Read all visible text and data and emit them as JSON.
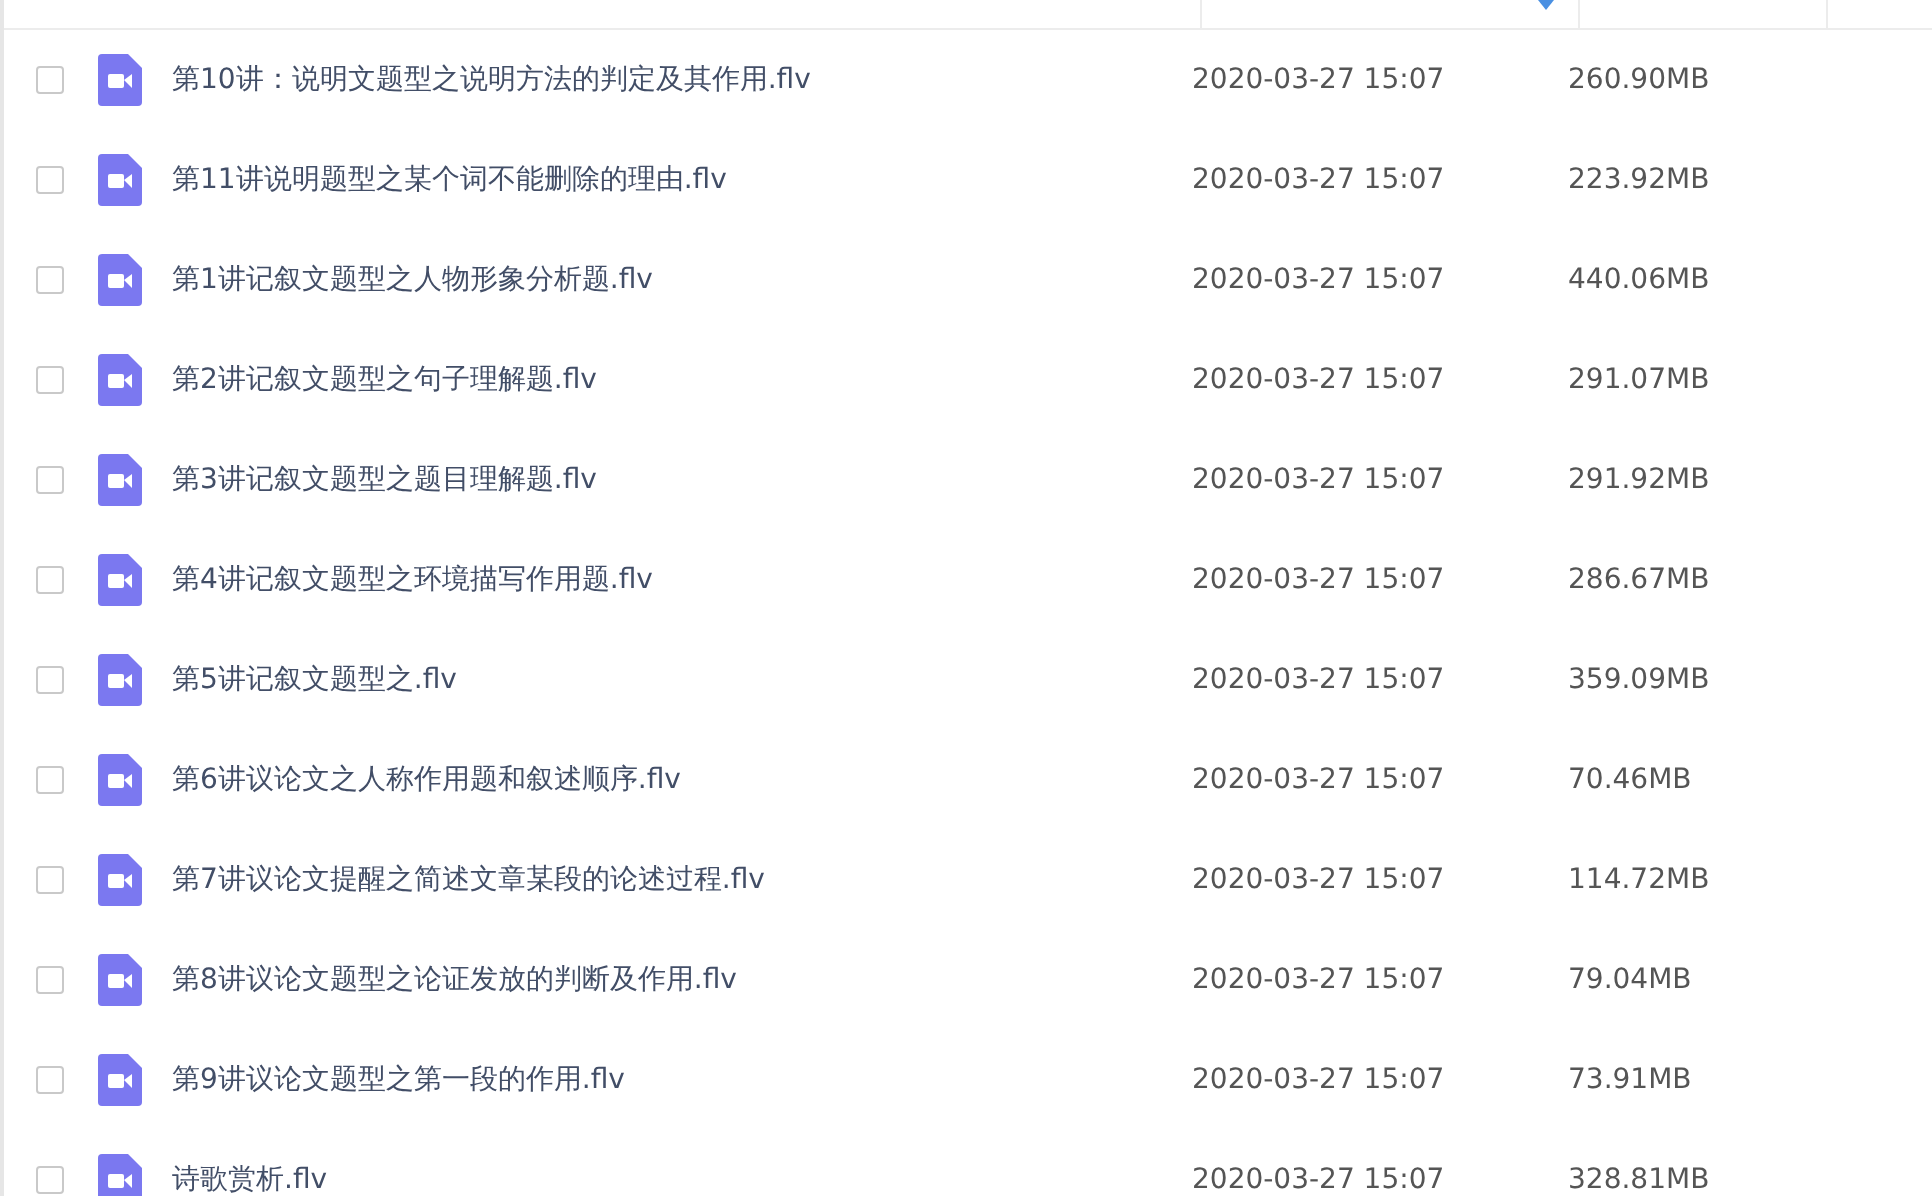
{
  "files": [
    {
      "name": "第10讲：说明文题型之说明方法的判定及其作用.flv",
      "modified": "2020-03-27 15:07",
      "size": "260.90MB",
      "checked": false
    },
    {
      "name": "第11讲说明题型之某个词不能删除的理由.flv",
      "modified": "2020-03-27 15:07",
      "size": "223.92MB",
      "checked": false
    },
    {
      "name": "第1讲记叙文题型之人物形象分析题.flv",
      "modified": "2020-03-27 15:07",
      "size": "440.06MB",
      "checked": false
    },
    {
      "name": "第2讲记叙文题型之句子理解题.flv",
      "modified": "2020-03-27 15:07",
      "size": "291.07MB",
      "checked": false
    },
    {
      "name": "第3讲记叙文题型之题目理解题.flv",
      "modified": "2020-03-27 15:07",
      "size": "291.92MB",
      "checked": false
    },
    {
      "name": "第4讲记叙文题型之环境描写作用题.flv",
      "modified": "2020-03-27 15:07",
      "size": "286.67MB",
      "checked": false
    },
    {
      "name": "第5讲记叙文题型之.flv",
      "modified": "2020-03-27 15:07",
      "size": "359.09MB",
      "checked": false
    },
    {
      "name": "第6讲议论文之人称作用题和叙述顺序.flv",
      "modified": "2020-03-27 15:07",
      "size": "70.46MB",
      "checked": false
    },
    {
      "name": "第7讲议论文提醒之简述文章某段的论述过程.flv",
      "modified": "2020-03-27 15:07",
      "size": "114.72MB",
      "checked": false
    },
    {
      "name": "第8讲议论文题型之论证发放的判断及作用.flv",
      "modified": "2020-03-27 15:07",
      "size": "79.04MB",
      "checked": false
    },
    {
      "name": "第9讲议论文题型之第一段的作用.flv",
      "modified": "2020-03-27 15:07",
      "size": "73.91MB",
      "checked": false
    },
    {
      "name": "诗歌赏析.flv",
      "modified": "2020-03-27 15:07",
      "size": "328.81MB",
      "checked": false
    }
  ]
}
